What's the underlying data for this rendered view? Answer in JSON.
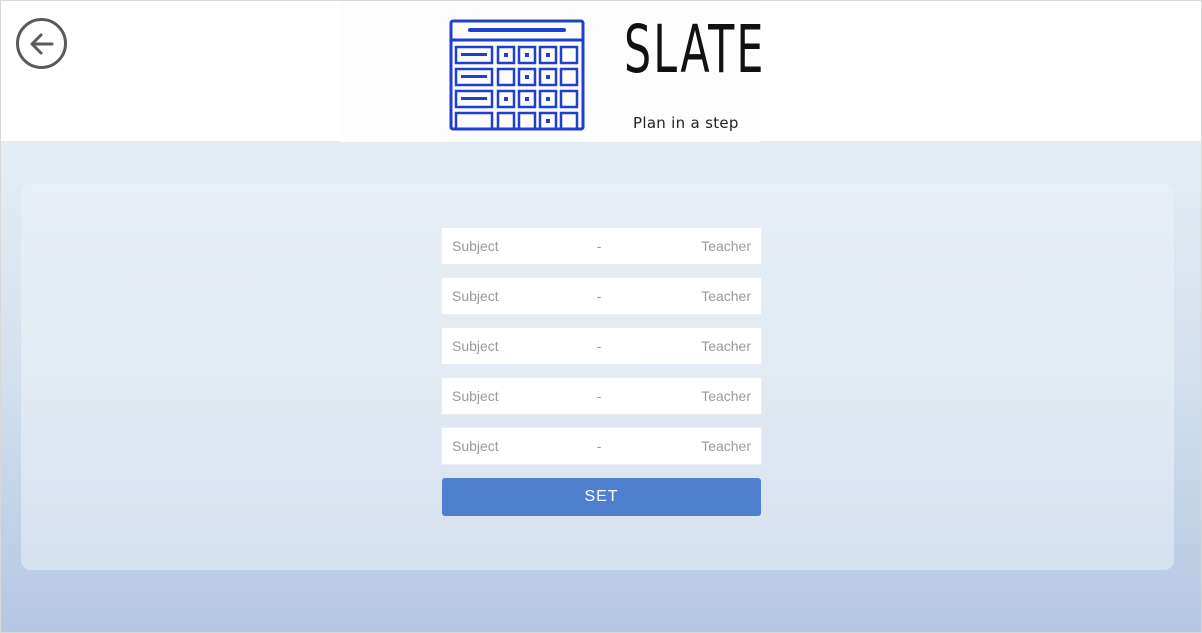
{
  "header": {
    "back_icon": "arrow-left-circle-icon",
    "brand_name": "SLATE",
    "tagline": "Plan in a step",
    "logo_icon": "timetable-grid-icon",
    "logo_color": "#1f3fcf"
  },
  "form": {
    "rows": [
      {
        "subject_placeholder": "Subject",
        "separator": "-",
        "teacher_placeholder": "Teacher"
      },
      {
        "subject_placeholder": "Subject",
        "separator": "-",
        "teacher_placeholder": "Teacher"
      },
      {
        "subject_placeholder": "Subject",
        "separator": "-",
        "teacher_placeholder": "Teacher"
      },
      {
        "subject_placeholder": "Subject",
        "separator": "-",
        "teacher_placeholder": "Teacher"
      },
      {
        "subject_placeholder": "Subject",
        "separator": "-",
        "teacher_placeholder": "Teacher"
      }
    ],
    "submit_label": "SET",
    "submit_color": "#4f80cf"
  }
}
